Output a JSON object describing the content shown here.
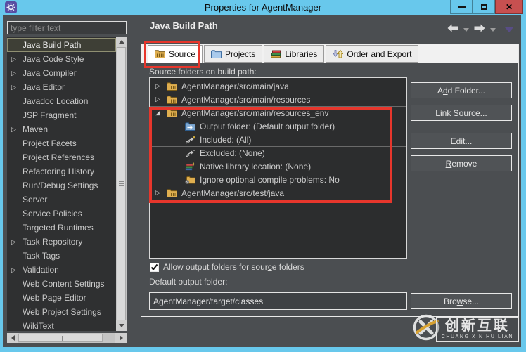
{
  "window": {
    "title": "Properties for AgentManager",
    "controls": {
      "minimize": "minimize",
      "maximize": "maximize",
      "close": "✕"
    }
  },
  "colors": {
    "titlebar": "#68C8EC",
    "close_button": "#C75050",
    "annotation_red": "#E7362C",
    "watermark_accent": "#E2A82F",
    "dialog_background": "#4B4E51"
  },
  "glyphs": {
    "collapsed": "▷",
    "expanded": "◢"
  },
  "sidebar": {
    "filter_placeholder": "type filter text",
    "items": [
      {
        "label": "Java Build Path",
        "selected": true,
        "expandable": false
      },
      {
        "label": "Java Code Style",
        "expandable": true
      },
      {
        "label": "Java Compiler",
        "expandable": true
      },
      {
        "label": "Java Editor",
        "expandable": true
      },
      {
        "label": "Javadoc Location",
        "expandable": false
      },
      {
        "label": "JSP Fragment",
        "expandable": false
      },
      {
        "label": "Maven",
        "expandable": true
      },
      {
        "label": "Project Facets",
        "expandable": false
      },
      {
        "label": "Project References",
        "expandable": false
      },
      {
        "label": "Refactoring History",
        "expandable": false
      },
      {
        "label": "Run/Debug Settings",
        "expandable": false
      },
      {
        "label": "Server",
        "expandable": false
      },
      {
        "label": "Service Policies",
        "expandable": false
      },
      {
        "label": "Targeted Runtimes",
        "expandable": false
      },
      {
        "label": "Task Repository",
        "expandable": true
      },
      {
        "label": "Task Tags",
        "expandable": false
      },
      {
        "label": "Validation",
        "expandable": true
      },
      {
        "label": "Web Content Settings",
        "expandable": false
      },
      {
        "label": "Web Page Editor",
        "expandable": false
      },
      {
        "label": "Web Project Settings",
        "expandable": false
      },
      {
        "label": "WikiText",
        "expandable": false
      }
    ]
  },
  "header": {
    "title": "Java Build Path"
  },
  "tabs": [
    {
      "label": "Source",
      "icon": "package-folder",
      "selected": true
    },
    {
      "label": "Projects",
      "icon": "blue-folder",
      "selected": false
    },
    {
      "label": "Libraries",
      "icon": "library-books",
      "selected": false
    },
    {
      "label": "Order and Export",
      "icon": "order-arrows",
      "selected": false
    }
  ],
  "source_panel": {
    "label": "Source folders on build path:",
    "tree": [
      {
        "level": 0,
        "state": "collapsed",
        "icon": "package-folder",
        "label": "AgentManager/src/main/java"
      },
      {
        "level": 0,
        "state": "collapsed",
        "icon": "package-folder",
        "label": "AgentManager/src/main/resources"
      },
      {
        "level": 0,
        "state": "expanded",
        "icon": "package-folder",
        "label": "AgentManager/src/main/resources_env",
        "outlined": true
      },
      {
        "level": 1,
        "icon": "output-folder",
        "label": "Output folder: (Default output folder)"
      },
      {
        "level": 1,
        "icon": "included",
        "label": "Included: (All)"
      },
      {
        "level": 1,
        "icon": "excluded",
        "label": "Excluded: (None)",
        "outlined": true
      },
      {
        "level": 1,
        "icon": "native-library",
        "label": "Native library location: (None)"
      },
      {
        "level": 1,
        "icon": "ignore-problems",
        "label": "Ignore optional compile problems: No"
      },
      {
        "level": 0,
        "state": "collapsed",
        "icon": "package-folder",
        "label": "AgentManager/src/test/java"
      }
    ],
    "buttons": [
      {
        "id": "add-folder",
        "pre": "A",
        "key": "d",
        "post": "d Folder..."
      },
      {
        "id": "link-source",
        "pre": "L",
        "key": "i",
        "post": "nk Source..."
      },
      {
        "id": "edit",
        "pre": "",
        "key": "E",
        "post": "dit..."
      },
      {
        "id": "remove",
        "pre": "",
        "key": "R",
        "post": "emove"
      }
    ]
  },
  "output": {
    "checkbox": {
      "checked": true,
      "pre": "Allow output folders for sour",
      "key": "c",
      "post": "e folders"
    },
    "default_label": "Default output folder:",
    "value": "AgentManager/target/classes",
    "browse": {
      "id": "browse",
      "pre": "Bro",
      "key": "w",
      "post": "se..."
    }
  },
  "watermark": {
    "cn": "创新互联",
    "en": "CHUANG XIN HU LIAN"
  }
}
